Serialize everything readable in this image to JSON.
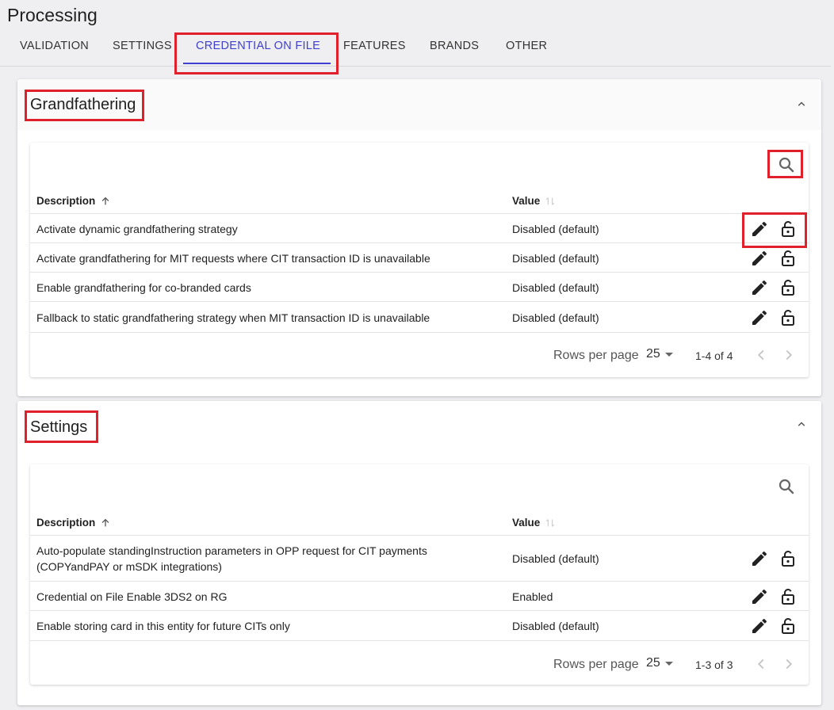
{
  "page": {
    "title": "Processing"
  },
  "tabs": [
    {
      "label": "VALIDATION"
    },
    {
      "label": "SETTINGS"
    },
    {
      "label": "CREDENTIAL ON FILE",
      "active": true
    },
    {
      "label": "FEATURES"
    },
    {
      "label": "BRANDS"
    },
    {
      "label": "OTHER"
    }
  ],
  "colors": {
    "accent": "#3f3fd1",
    "highlight": "#e0202a",
    "background": "#efeff2"
  },
  "grandfathering": {
    "title": "Grandfathering",
    "columns": {
      "description": "Description",
      "value": "Value"
    },
    "rows": [
      {
        "description": "Activate dynamic grandfathering strategy",
        "value": "Disabled (default)"
      },
      {
        "description": "Activate grandfathering for MIT requests where CIT transaction ID is unavailable",
        "value": "Disabled (default)"
      },
      {
        "description": "Enable grandfathering for co-branded cards",
        "value": "Disabled (default)"
      },
      {
        "description": "Fallback to static grandfathering strategy when MIT transaction ID is unavailable",
        "value": "Disabled (default)"
      }
    ],
    "footer": {
      "rows_per_page_label": "Rows per page",
      "rows_per_page": "25",
      "range": "1-4 of 4"
    }
  },
  "settings": {
    "title": "Settings",
    "columns": {
      "description": "Description",
      "value": "Value"
    },
    "rows": [
      {
        "description_line1": "Auto-populate standingInstruction parameters in OPP request for CIT payments",
        "description_line2": "(COPYandPAY or mSDK integrations)",
        "value": "Disabled (default)"
      },
      {
        "description": "Credential on File Enable 3DS2 on RG",
        "value": "Enabled"
      },
      {
        "description": "Enable storing card in this entity for future CITs only",
        "value": "Disabled (default)"
      }
    ],
    "footer": {
      "rows_per_page_label": "Rows per page",
      "rows_per_page": "25",
      "range": "1-3 of 3"
    }
  },
  "icons": {
    "collapse": "chevron-up-icon",
    "search": "search-icon",
    "sort_asc": "arrow-up-icon",
    "sort_none": "sort-icon",
    "edit": "pencil-icon",
    "lock": "lock-open-icon",
    "dropdown": "caret-down-icon",
    "prev": "chevron-left-icon",
    "next": "chevron-right-icon"
  }
}
